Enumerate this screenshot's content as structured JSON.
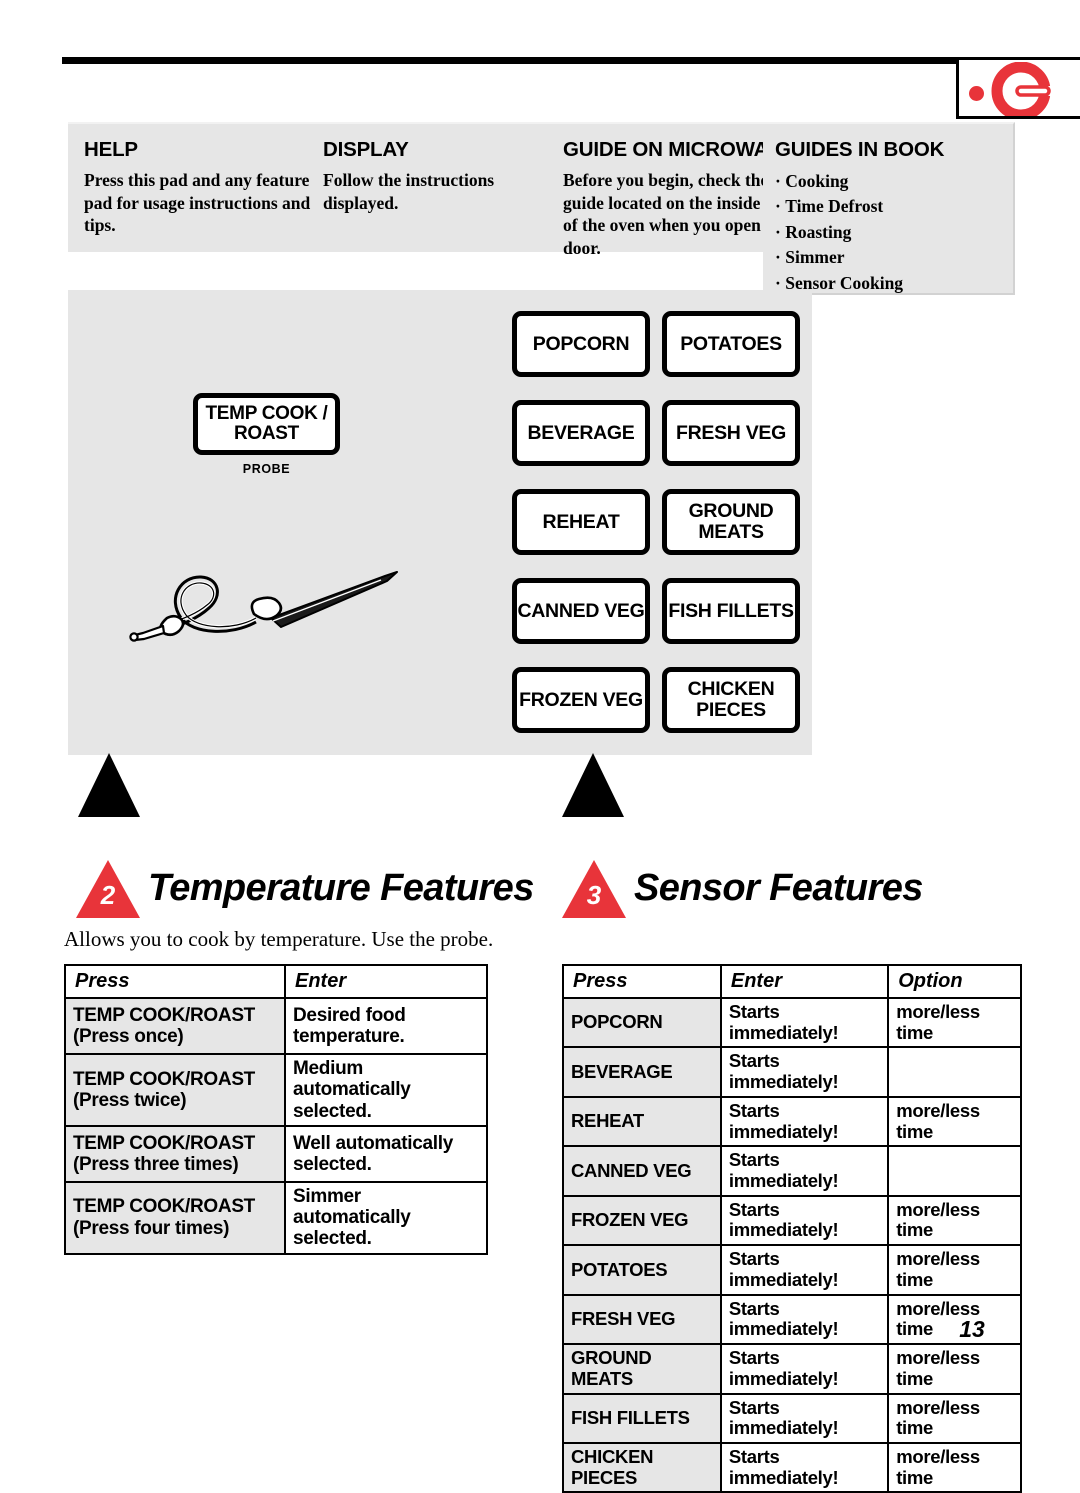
{
  "brand": {
    "logo_name": "ge-monogram-logo",
    "accent_color": "#E8343A"
  },
  "info_band": {
    "columns": [
      {
        "heading": "HELP",
        "body": "Press this pad and any feature pad for usage instructions and tips."
      },
      {
        "heading": "DISPLAY",
        "body": "Follow the instructions displayed."
      },
      {
        "heading": "GUIDE ON MICROWAVE",
        "body": "Before you begin, check the guide located on the inside front of the oven when you open the door."
      }
    ],
    "guides_in_book": {
      "heading": "GUIDES IN BOOK",
      "items": [
        "Cooking",
        "Time Defrost",
        "Roasting",
        "Simmer",
        "Sensor Cooking"
      ]
    }
  },
  "control_panel": {
    "temp_pad_label": "TEMP COOK / ROAST",
    "probe_caption": "PROBE",
    "sensor_pads": [
      "POPCORN",
      "POTATOES",
      "BEVERAGE",
      "FRESH VEG",
      "REHEAT",
      "GROUND MEATS",
      "CANNED VEG",
      "FISH FILLETS",
      "FROZEN VEG",
      "CHICKEN PIECES"
    ]
  },
  "sections": [
    {
      "number": "2",
      "title": "Temperature Features",
      "subtitle": "Allows you to cook by temperature. Use the probe."
    },
    {
      "number": "3",
      "title": "Sensor Features",
      "subtitle": ""
    }
  ],
  "temperature_table": {
    "headers": [
      "Press",
      "Enter"
    ],
    "rows": [
      {
        "press": "TEMP COOK/ROAST",
        "press_sub": "(Press once)",
        "enter": "Desired food temperature."
      },
      {
        "press": "TEMP COOK/ROAST",
        "press_sub": "(Press twice)",
        "enter": "Medium automatically selected."
      },
      {
        "press": "TEMP COOK/ROAST",
        "press_sub": "(Press three times)",
        "enter": "Well automatically selected."
      },
      {
        "press": "TEMP COOK/ROAST",
        "press_sub": "(Press four times)",
        "enter": "Simmer automatically selected."
      }
    ]
  },
  "sensor_table": {
    "headers": [
      "Press",
      "Enter",
      "Option"
    ],
    "rows": [
      {
        "press": "POPCORN",
        "enter": "Starts immediately!",
        "option": "more/less time"
      },
      {
        "press": "BEVERAGE",
        "enter": "Starts immediately!",
        "option": ""
      },
      {
        "press": "REHEAT",
        "enter": "Starts immediately!",
        "option": "more/less time"
      },
      {
        "press": "CANNED VEG",
        "enter": "Starts immediately!",
        "option": ""
      },
      {
        "press": "FROZEN VEG",
        "enter": "Starts immediately!",
        "option": "more/less time"
      },
      {
        "press": "POTATOES",
        "enter": "Starts immediately!",
        "option": "more/less time"
      },
      {
        "press": "FRESH VEG",
        "enter": "Starts immediately!",
        "option": "more/less time"
      },
      {
        "press": "GROUND MEATS",
        "enter": "Starts immediately!",
        "option": "more/less time"
      },
      {
        "press": "FISH FILLETS",
        "enter": "Starts immediately!",
        "option": "more/less time"
      },
      {
        "press": "CHICKEN PIECES",
        "enter": "Starts immediately!",
        "option": "more/less time"
      }
    ]
  },
  "page_number": "13"
}
